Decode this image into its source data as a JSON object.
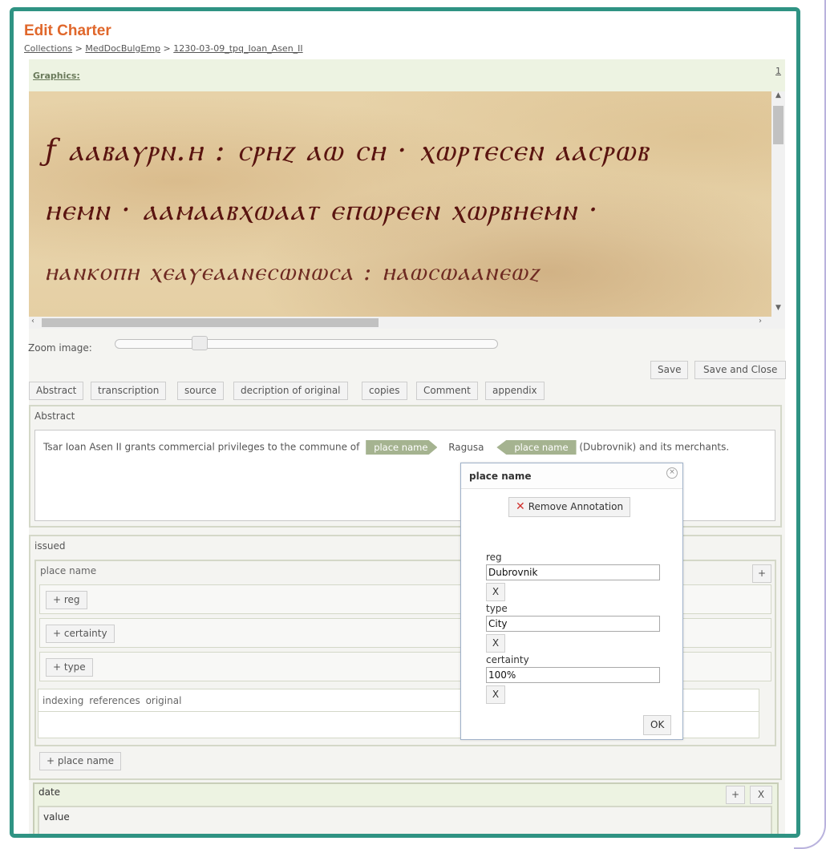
{
  "page": {
    "title": "Edit Charter",
    "breadcrumb": {
      "item1": "Collections",
      "sep1": " > ",
      "item2": "MedDocBulgEmp",
      "sep2": " > ",
      "item3": "1230-03-09_tpq_Ioan_Asen_II"
    }
  },
  "graphics": {
    "label": "Graphics:",
    "page_number": "1"
  },
  "image": {
    "line1": "ƒ ⲁⲁⲃⲁⲩⲣⲛ.ⲏ : ⲥⲣⲏⲍ ⲁⲱ ⲥⲏ · ⲭⲱⲣⲧⲉⲥⲉⲛ ⲁⲁⲥⲣⲱⲃ",
    "line2": "ⲏⲉⲙⲛ · ⲁⲁⲙⲁⲁⲃⲭⲱⲁⲁⲧ ⲉⲡⲱⲣⲉⲉⲛ ⲭⲱⲣⲃⲏⲉⲙⲛ ·",
    "line3": "ⲏⲁⲛⲕⲟⲡⲏ ⲭⲉⲁⲩⲉⲁⲁⲛⲉⲥⲱⲛⲱⲥⲁ : ⲏⲁⲱⲥⲱⲁⲁⲛⲉⲱⲍ"
  },
  "zoom": {
    "label": "Zoom image:",
    "value": 0.22
  },
  "actions": {
    "save": "Save",
    "save_close": "Save and Close"
  },
  "tabs": [
    "Abstract",
    "transcription",
    "source",
    "decription of original",
    "copies",
    "Comment",
    "appendix"
  ],
  "abstract": {
    "title": "Abstract",
    "text_before": "Tsar Ioan Asen II grants commercial privileges to the commune of",
    "tag_open": "place name",
    "place": "Ragusa",
    "tag_close": "place name",
    "text_after": "(Dubrovnik) and its merchants."
  },
  "issued": {
    "title": "issued",
    "place_name_title": "place name",
    "add_reg": "+ reg",
    "add_certainty": "+ certainty",
    "add_type": "+ type",
    "indexing": "indexing  references  original",
    "add_place_name": "+ place name",
    "plus": "+"
  },
  "date": {
    "title": "date",
    "value_title": "value",
    "plus": "+",
    "x": "X"
  },
  "dialog": {
    "title": "place name",
    "remove": "Remove Annotation",
    "reg_label": "reg",
    "reg_value": "Dubrovnik",
    "type_label": "type",
    "type_value": "City",
    "certainty_label": "certainty",
    "certainty_value": "100%",
    "x": "X",
    "ok": "OK"
  },
  "colors": {
    "accent_title": "#e0672b",
    "frame": "#2f9383",
    "tag": "#a5b390",
    "panel_header": "#edf3e2",
    "remove_icon": "#d0312d"
  }
}
